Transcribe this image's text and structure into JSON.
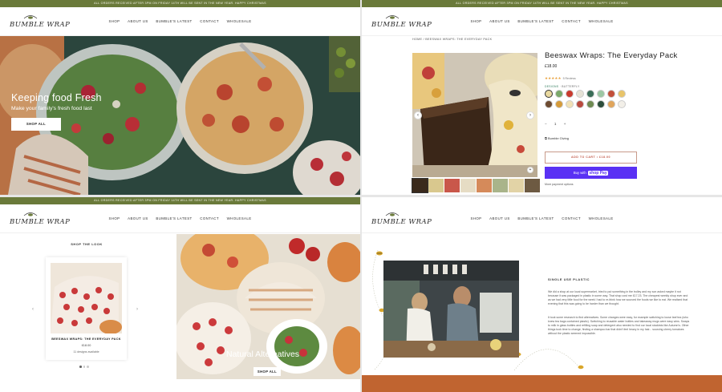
{
  "announcement": "ALL ORDERS RECEIVED AFTER 3PM ON FRIDAY 14TH WILL BE SENT IN THE NEW YEAR. HAPPY CHRISTMAS",
  "brand": {
    "logo_text": "BUMBLE WRAP"
  },
  "nav": [
    "SHOP",
    "ABOUT US",
    "BUMBLE'S LATEST",
    "CONTACT",
    "WHOLESALE"
  ],
  "panels": {
    "home_hero": {
      "title": "Keeping food Fresh",
      "subtitle": "Make your family's fresh food last",
      "button": "SHOP ALL"
    },
    "product": {
      "breadcrumb": "HOME  /  BEESWAX WRAPS: THE EVERYDAY PACK",
      "title": "Beeswax Wraps: The Everyday Pack",
      "price": "£18.00",
      "stars": "★★★★★",
      "reviews": "5 Reviews",
      "variant_label": "DESIGNS",
      "variant_value": "BUTTERFLY",
      "quantity": "1",
      "gift_text": "Bumble Giving",
      "add_to_cart": "ADD TO CART • £18.00",
      "shop_pay_prefix": "Buy with",
      "shop_pay_brand": "shop Pay",
      "more_payment": "More payment options",
      "swatch_colors": [
        "#e9d9a0",
        "#7aa86a",
        "#c93a2e",
        "#e6e2d6",
        "#3b6d58",
        "#9cc7a3",
        "#c24f3a",
        "#e8c46a",
        "#6d4b31",
        "#d59b3a",
        "#f0e1b6",
        "#b94a3f",
        "#6f8a52",
        "#2c4d3b",
        "#e0a55c",
        "#f2efe8"
      ]
    },
    "shop_look": {
      "heading": "SHOP THE LOOK",
      "card_name": "BEESWAX WRAPS: THE EVERYDAY PACK",
      "card_price": "£18.00",
      "card_desc": "11 designs available",
      "hero_title": "Natural Alternatives",
      "hero_button": "SHOP ALL"
    },
    "story": {
      "heading": "SINGLE USE PLASTIC",
      "para1": "We did a shop at our local supermarket, tried to put something in the trolley and my son asked maybe it not because it was packaged in plastic in some way. That shop cost me £17.23. The cheapest weekly shop ever and as we had very little food for the week I had to re-think how we sourced the foods we like to eat. We realised that evening that this was going to be harder than we thought.",
      "para2": "It took some research to find alternatives. Some changes were easy, for example switching to loose leaf tea (who knew tea bags contained plastic). Switching to reusable water bottles and takeaway mugs were easy wins. Swaps to milk in glass bottles and refilling soap and detergent also needed to find our local stockists like Autumn's. Other things took time to change, finding a shampoo bar that didn't feel heavy in my hair... sourcing cherry tomatoes without the plastic seemed impossible."
    }
  },
  "colors": {
    "announcement_bg": "#6a7a3a",
    "shop_pay": "#5a31f4",
    "rust_band": "#c06430",
    "star": "#e9a13b"
  }
}
